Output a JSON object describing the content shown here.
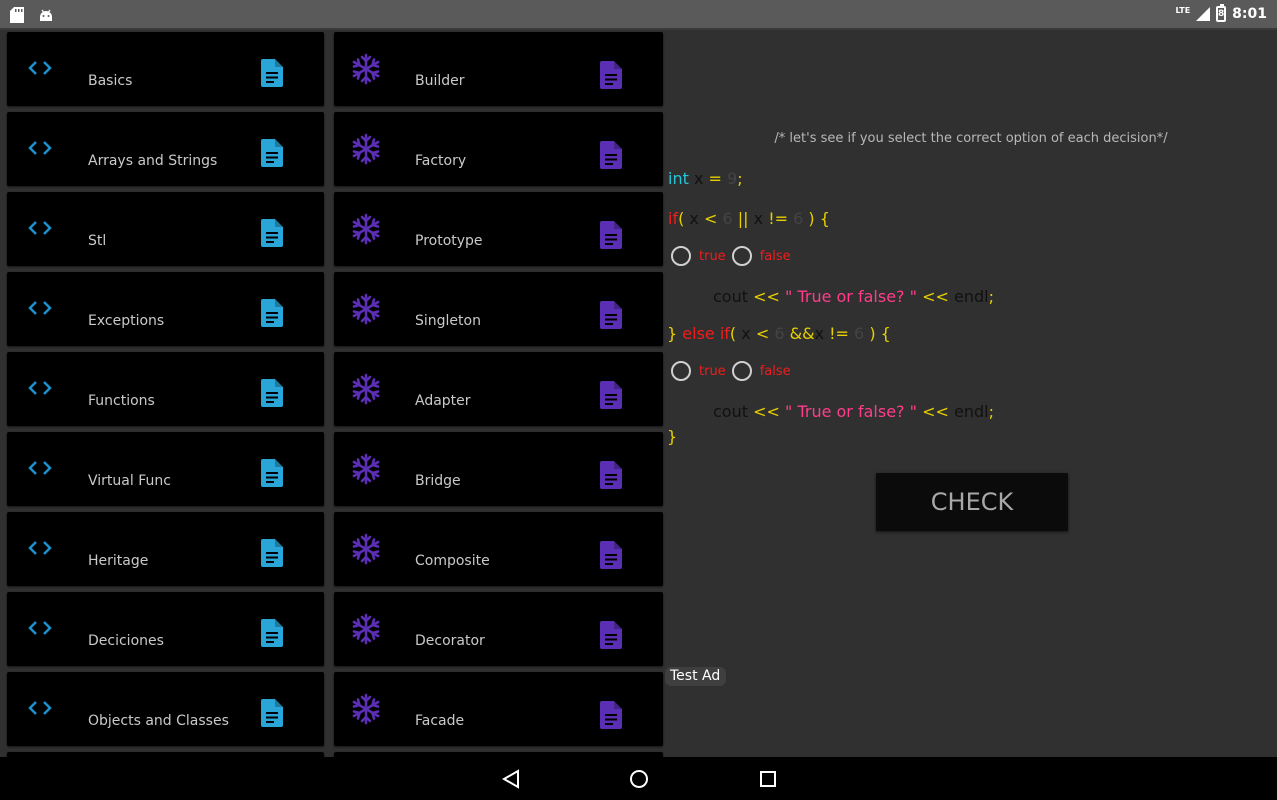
{
  "status_bar": {
    "network": "LTE",
    "battery_level": "8",
    "time": "8:01",
    "left_icons": [
      "sd-card-icon",
      "android-debug-icon"
    ]
  },
  "topics_column": {
    "items": [
      {
        "label": "Basics"
      },
      {
        "label": "Arrays and Strings"
      },
      {
        "label": "Stl"
      },
      {
        "label": "Exceptions"
      },
      {
        "label": "Functions"
      },
      {
        "label": "Virtual Func"
      },
      {
        "label": "Heritage"
      },
      {
        "label": "Deciciones"
      },
      {
        "label": "Objects and Classes"
      }
    ],
    "icon": "code-brackets-icon",
    "doc_icon_color": "#2aa5d8",
    "icon_color": "#1e8fc7"
  },
  "patterns_column": {
    "items": [
      {
        "label": "Builder"
      },
      {
        "label": "Factory"
      },
      {
        "label": "Prototype"
      },
      {
        "label": "Singleton"
      },
      {
        "label": "Adapter"
      },
      {
        "label": "Bridge"
      },
      {
        "label": "Composite"
      },
      {
        "label": "Decorator"
      },
      {
        "label": "Facade"
      }
    ],
    "icon": "snowflake-icon",
    "icon_color": "#5b2fb5"
  },
  "quiz": {
    "comment": "/* let's see if you select the correct option of each decision*/",
    "line1": {
      "kw": "int",
      "var": "x",
      "eq": "=",
      "num": "9",
      "semi": ";"
    },
    "line2": {
      "kw": "if",
      "open": "(",
      "v1": "x",
      "op1": "<",
      "n1": "6",
      "or": "||",
      "v2": "x",
      "op2": "!=",
      "n2": "6",
      "close": ")",
      "brace": "{"
    },
    "line3": {
      "fn": "cout",
      "op": "<<",
      "str": "\" True or false? \"",
      "op2": "<<",
      "endl": "endl",
      "semi": ";"
    },
    "line4": {
      "close": "}",
      "kw": "else if",
      "open": "(",
      "v1": "x",
      "op1": "<",
      "n1": "6",
      "and": "&&",
      "v2": "x",
      "op2": "!=",
      "n2": "6",
      "close2": ")",
      "brace": "{"
    },
    "line5": {
      "fn": "cout",
      "op": "<<",
      "str": "\" True or false? \"",
      "op2": "<<",
      "endl": "endl",
      "semi": ";"
    },
    "line6": {
      "brace": "}"
    },
    "option_true": "true",
    "option_false": "false",
    "check_label": "CHECK",
    "ad_label": "Test Ad"
  }
}
